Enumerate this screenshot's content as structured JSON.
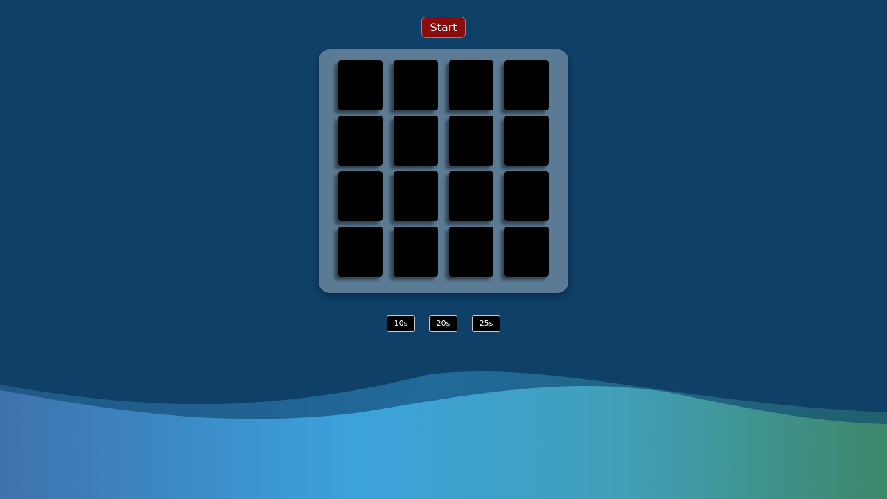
{
  "start_button": {
    "label": "Start"
  },
  "board": {
    "rows": 4,
    "columns": 4,
    "card_state": "face-down"
  },
  "time_options": [
    {
      "label": "10s"
    },
    {
      "label": "20s"
    },
    {
      "label": "25s"
    }
  ],
  "colors": {
    "background": "#0e4068",
    "board": "#5b7b94",
    "card_back": "#000000",
    "start_button": "#8a0c0c",
    "wave_left": "#3d77b0",
    "wave_mid": "#3ca1d8",
    "wave_right": "#3d8a6a"
  }
}
